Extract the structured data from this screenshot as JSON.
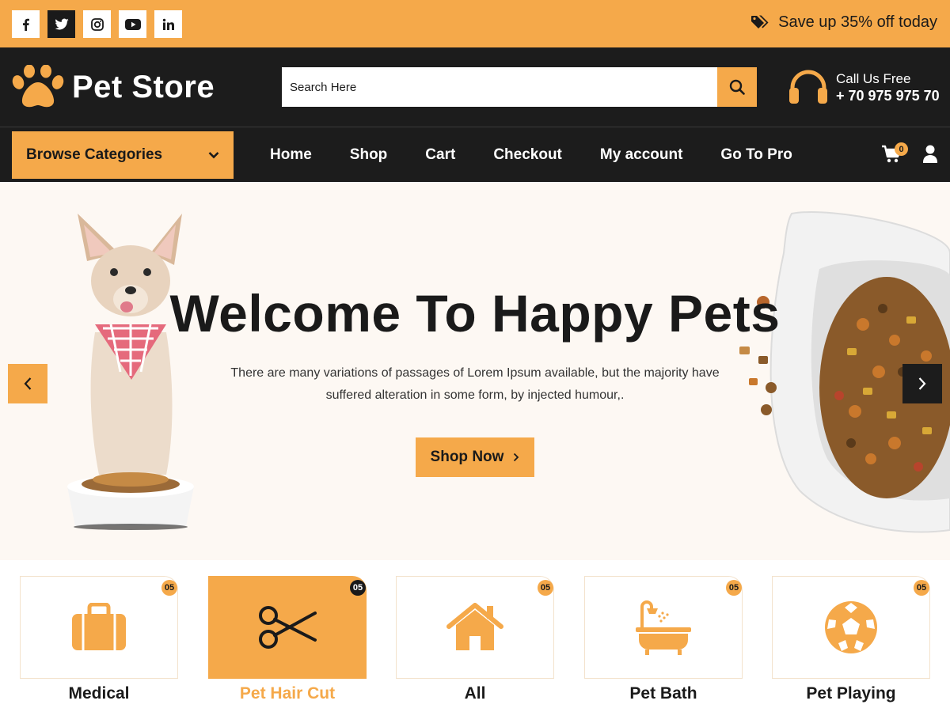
{
  "topbar": {
    "social": [
      {
        "name": "facebook",
        "icon": "facebook-icon"
      },
      {
        "name": "twitter",
        "icon": "twitter-icon"
      },
      {
        "name": "instagram",
        "icon": "instagram-icon"
      },
      {
        "name": "youtube",
        "icon": "youtube-icon"
      },
      {
        "name": "linkedin",
        "icon": "linkedin-icon"
      }
    ],
    "promo_text": "Save up 35% off today",
    "promo_icon": "tags-icon"
  },
  "header": {
    "logo_text": "Pet Store",
    "logo_icon": "paw-icon",
    "search_placeholder": "Search Here",
    "search_icon": "search-icon",
    "contact_label": "Call Us Free",
    "contact_phone": "+ 70 975 975 70",
    "contact_icon": "headphones-icon"
  },
  "nav": {
    "browse_label": "Browse Categories",
    "menu": [
      "Home",
      "Shop",
      "Cart",
      "Checkout",
      "My account",
      "Go To Pro"
    ],
    "cart_count": "0"
  },
  "hero": {
    "title": "Welcome To Happy Pets",
    "subtitle": "There are many variations of passages of Lorem Ipsum available, but the majority have suffered alteration in some form, by injected humour,.",
    "cta_label": "Shop Now"
  },
  "categories": [
    {
      "label": "Medical",
      "count": "05",
      "icon": "medical-bag-icon"
    },
    {
      "label": "Pet Hair Cut",
      "count": "05",
      "icon": "scissors-icon"
    },
    {
      "label": "All",
      "count": "05",
      "icon": "home-icon"
    },
    {
      "label": "Pet Bath",
      "count": "05",
      "icon": "bathtub-icon"
    },
    {
      "label": "Pet Playing",
      "count": "05",
      "icon": "soccer-ball-icon"
    }
  ],
  "colors": {
    "accent": "#f5a94a",
    "dark": "#1c1c1c",
    "hero_bg": "#fdf8f3"
  }
}
